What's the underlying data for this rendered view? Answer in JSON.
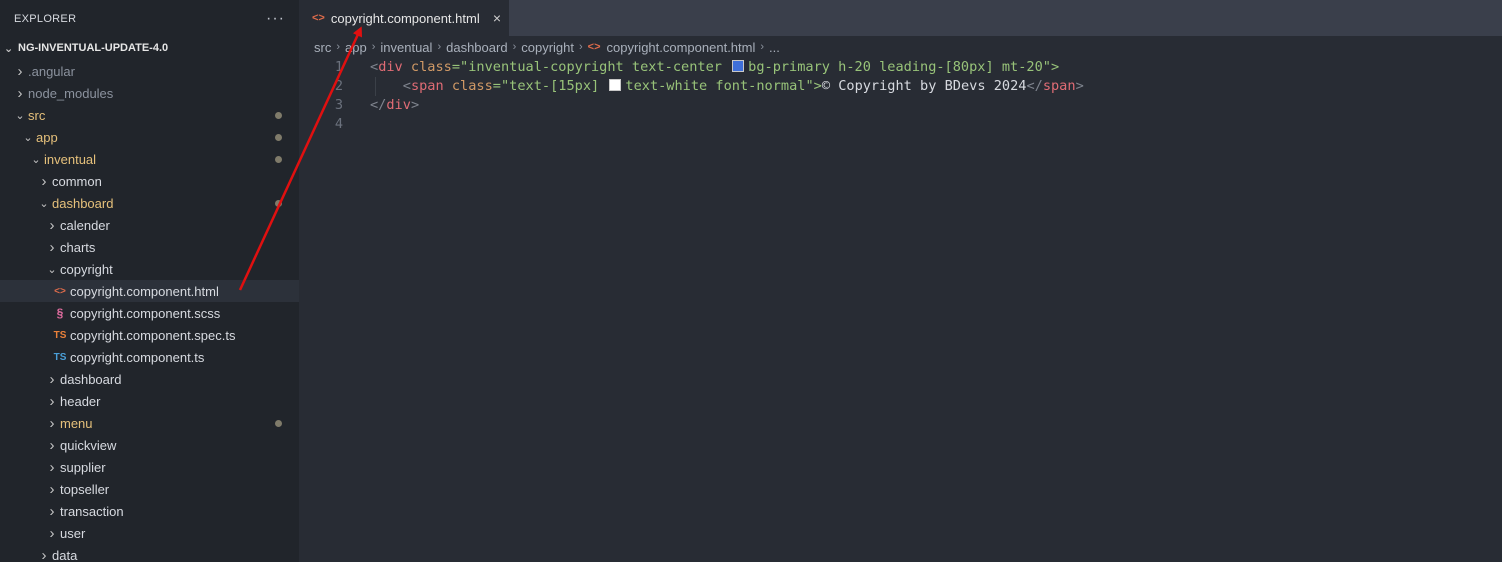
{
  "sidebar": {
    "title": "EXPLORER",
    "more_label": "···",
    "project": "NG-INVENTUAL-UPDATE-4.0",
    "tree": [
      {
        "label": ".angular",
        "indent": 1,
        "type": "folder",
        "open": false,
        "dim": true
      },
      {
        "label": "node_modules",
        "indent": 1,
        "type": "folder",
        "open": false,
        "dim": true
      },
      {
        "label": "src",
        "indent": 1,
        "type": "folder",
        "open": true,
        "mod": true,
        "dot": true
      },
      {
        "label": "app",
        "indent": 2,
        "type": "folder",
        "open": true,
        "mod": true,
        "dot": true
      },
      {
        "label": "inventual",
        "indent": 3,
        "type": "folder",
        "open": true,
        "mod": true,
        "dot": true
      },
      {
        "label": "common",
        "indent": 4,
        "type": "folder",
        "open": false
      },
      {
        "label": "dashboard",
        "indent": 4,
        "type": "folder",
        "open": true,
        "mod": true,
        "dot": true
      },
      {
        "label": "calender",
        "indent": 5,
        "type": "folder",
        "open": false
      },
      {
        "label": "charts",
        "indent": 5,
        "type": "folder",
        "open": false
      },
      {
        "label": "copyright",
        "indent": 5,
        "type": "folder",
        "open": true
      },
      {
        "label": "copyright.component.html",
        "indent": 6,
        "type": "file",
        "icon": "html",
        "selected": true
      },
      {
        "label": "copyright.component.scss",
        "indent": 6,
        "type": "file",
        "icon": "scss"
      },
      {
        "label": "copyright.component.spec.ts",
        "indent": 6,
        "type": "file",
        "icon": "ts-orange"
      },
      {
        "label": "copyright.component.ts",
        "indent": 6,
        "type": "file",
        "icon": "ts-blue"
      },
      {
        "label": "dashboard",
        "indent": 5,
        "type": "folder",
        "open": false
      },
      {
        "label": "header",
        "indent": 5,
        "type": "folder",
        "open": false
      },
      {
        "label": "menu",
        "indent": 5,
        "type": "folder",
        "open": false,
        "mod": true,
        "dot": true
      },
      {
        "label": "quickview",
        "indent": 5,
        "type": "folder",
        "open": false
      },
      {
        "label": "supplier",
        "indent": 5,
        "type": "folder",
        "open": false
      },
      {
        "label": "topseller",
        "indent": 5,
        "type": "folder",
        "open": false
      },
      {
        "label": "transaction",
        "indent": 5,
        "type": "folder",
        "open": false
      },
      {
        "label": "user",
        "indent": 5,
        "type": "folder",
        "open": false
      },
      {
        "label": "data",
        "indent": 4,
        "type": "folder",
        "open": false
      }
    ]
  },
  "editor": {
    "tab": {
      "label": "copyright.component.html",
      "icon": "html-file-icon",
      "close": "×"
    },
    "breadcrumb": [
      "src",
      "app",
      "inventual",
      "dashboard",
      "copyright",
      "copyright.component.html",
      "..."
    ],
    "line_numbers": [
      "1",
      "2",
      "3",
      "4"
    ],
    "code": {
      "l1_open": "<",
      "l1_tag": "div",
      "l1_attr": " class",
      "l1_eq": "=\"",
      "l1_cls_a": "inventual-copyright text-center ",
      "l1_cls_b": "bg-primary h-20 leading-[80px] mt-20",
      "l1_close": "\">",
      "l2_indent": "    ",
      "l2_open": "<",
      "l2_tag": "span",
      "l2_attr": " class",
      "l2_eq": "=\"",
      "l2_cls_a": "text-[15px] ",
      "l2_cls_b": "text-white font-normal",
      "l2_close": "\">",
      "l2_text": "© Copyright by BDevs 2024",
      "l2_end_open": "</",
      "l2_end_tag": "span",
      "l2_end_close": ">",
      "l3_open": "</",
      "l3_tag": "div",
      "l3_close": ">"
    },
    "swatch_colors": {
      "primary": "#3f6fd8",
      "white": "#ffffff"
    }
  },
  "annotation": {
    "color": "#e01010"
  }
}
